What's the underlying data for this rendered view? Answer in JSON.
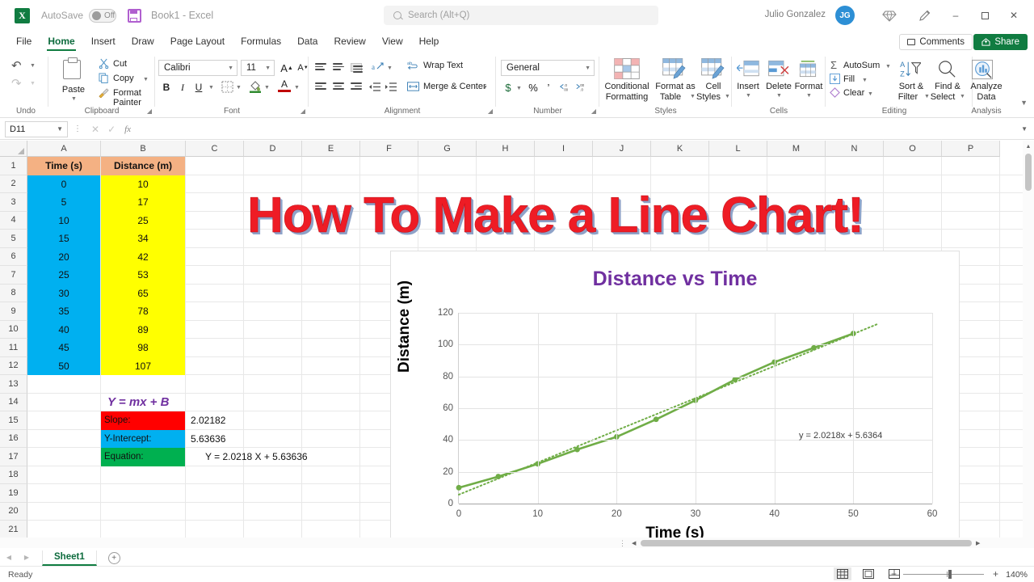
{
  "app": {
    "logo_text": "X",
    "autosave_label": "AutoSave",
    "autosave_state": "Off",
    "document_title": "Book1  -  Excel",
    "user_name": "Julio Gonzalez",
    "user_initials": "JG"
  },
  "search": {
    "placeholder": "Search (Alt+Q)"
  },
  "window_controls": {
    "minimize": "–",
    "maximize": "□",
    "close": "✕"
  },
  "menu": {
    "tabs": [
      {
        "label": "File",
        "active": false
      },
      {
        "label": "Home",
        "active": true
      },
      {
        "label": "Insert",
        "active": false
      },
      {
        "label": "Draw",
        "active": false
      },
      {
        "label": "Page Layout",
        "active": false
      },
      {
        "label": "Formulas",
        "active": false
      },
      {
        "label": "Data",
        "active": false
      },
      {
        "label": "Review",
        "active": false
      },
      {
        "label": "View",
        "active": false
      },
      {
        "label": "Help",
        "active": false
      }
    ],
    "comments_label": "Comments",
    "share_label": "Share"
  },
  "ribbon": {
    "groups": [
      {
        "name": "Undo"
      },
      {
        "name": "Clipboard"
      },
      {
        "name": "Font"
      },
      {
        "name": "Alignment"
      },
      {
        "name": "Number"
      },
      {
        "name": "Styles"
      },
      {
        "name": "Cells"
      },
      {
        "name": "Editing"
      },
      {
        "name": "Analysis"
      }
    ],
    "clipboard": {
      "paste": "Paste",
      "cut": "Cut",
      "copy": "Copy",
      "format_painter": "Format Painter"
    },
    "font": {
      "family": "Calibri",
      "size": "11",
      "grow": "A",
      "shrink": "A",
      "bold": "B",
      "italic": "I",
      "underline": "U"
    },
    "alignment": {
      "wrap_text": "Wrap Text",
      "merge_center": "Merge & Center"
    },
    "number": {
      "format": "General",
      "currency": "$",
      "percent": "%",
      "comma": "’"
    },
    "styles": {
      "conditional_formatting": "Conditional\nFormatting",
      "conditional_formatting_l1": "Conditional",
      "conditional_formatting_l2": "Formatting",
      "format_as_table_l1": "Format as",
      "format_as_table_l2": "Table",
      "cell_styles_l1": "Cell",
      "cell_styles_l2": "Styles"
    },
    "cells": {
      "insert": "Insert",
      "delete": "Delete",
      "format": "Format"
    },
    "editing": {
      "autosum": "AutoSum",
      "fill": "Fill",
      "clear": "Clear",
      "sort_filter_l1": "Sort &",
      "sort_filter_l2": "Filter",
      "find_select_l1": "Find &",
      "find_select_l2": "Select"
    },
    "analysis": {
      "analyze_data_l1": "Analyze",
      "analyze_data_l2": "Data"
    }
  },
  "formula_bar": {
    "name_box": "D11",
    "formula_value": "",
    "cancel": "✕",
    "enter": "✓",
    "fx": "fx"
  },
  "grid": {
    "column_headers": [
      "A",
      "B",
      "C",
      "D",
      "E",
      "F",
      "G",
      "H",
      "I",
      "J",
      "K",
      "L",
      "M",
      "N",
      "O",
      "P"
    ],
    "row_numbers": [
      "1",
      "2",
      "3",
      "4",
      "5",
      "6",
      "7",
      "8",
      "9",
      "10",
      "11",
      "12",
      "13",
      "14",
      "15",
      "16",
      "17",
      "18",
      "19",
      "20",
      "21"
    ],
    "cells": {
      "A1": "Time (s)",
      "B1": "Distance (m)",
      "A2": "0",
      "B2": "10",
      "A3": "5",
      "B3": "17",
      "A4": "10",
      "B4": "25",
      "A5": "15",
      "B5": "34",
      "A6": "20",
      "B6": "42",
      "A7": "25",
      "B7": "53",
      "A8": "30",
      "B8": "65",
      "A9": "35",
      "B9": "78",
      "A10": "40",
      "B10": "89",
      "A11": "45",
      "B11": "98",
      "A12": "50",
      "B12": "107",
      "B14": "Y = mx + B",
      "B15": "Slope:",
      "C15": "2.02182",
      "B16": "Y-Intercept:",
      "C16": "5.63636",
      "B17": "Equation:",
      "C17": "Y = 2.0218 X + 5.63636"
    }
  },
  "overlay_title": {
    "text": "How To Make a Line Chart!"
  },
  "chart_data": {
    "type": "line",
    "title": "Distance vs Time",
    "xlabel": "Time (s)",
    "ylabel": "Distance (m)",
    "x": [
      0,
      5,
      10,
      15,
      20,
      25,
      30,
      35,
      40,
      45,
      50
    ],
    "values": [
      10,
      17,
      25,
      34,
      42,
      53,
      65,
      78,
      89,
      98,
      107
    ],
    "series": [
      {
        "name": "Distance (m)",
        "values": [
          10,
          17,
          25,
          34,
          42,
          53,
          65,
          78,
          89,
          98,
          107
        ]
      }
    ],
    "xlim": [
      0,
      60
    ],
    "ylim": [
      0,
      120
    ],
    "xticks": [
      0,
      10,
      20,
      30,
      40,
      50,
      60
    ],
    "yticks": [
      0,
      20,
      40,
      60,
      80,
      100,
      120
    ],
    "grid": true,
    "legend": false,
    "line_color": "#70ad47",
    "marker": "circle",
    "trendline": {
      "type": "linear",
      "label": "y = 2.0218x + 5.6364",
      "slope": 2.0218,
      "intercept": 5.6364,
      "style": "dotted"
    }
  },
  "sheet_tabs": {
    "tabs": [
      "Sheet1"
    ],
    "add_label": "+"
  },
  "status_bar": {
    "status": "Ready",
    "zoom": "140%",
    "zoom_minus": "−",
    "zoom_plus": "+"
  }
}
